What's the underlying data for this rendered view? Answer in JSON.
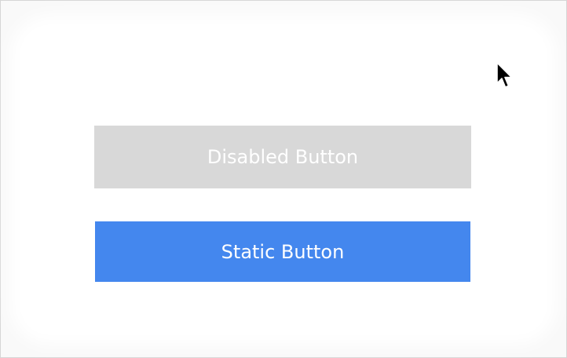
{
  "buttons": {
    "disabled": {
      "label": "Disabled Button",
      "state": "disabled",
      "color": "#d8d8d8"
    },
    "static": {
      "label": "Static Button",
      "state": "enabled",
      "color": "#4487ee"
    }
  },
  "cursor": {
    "icon": "arrow-pointer-icon"
  }
}
